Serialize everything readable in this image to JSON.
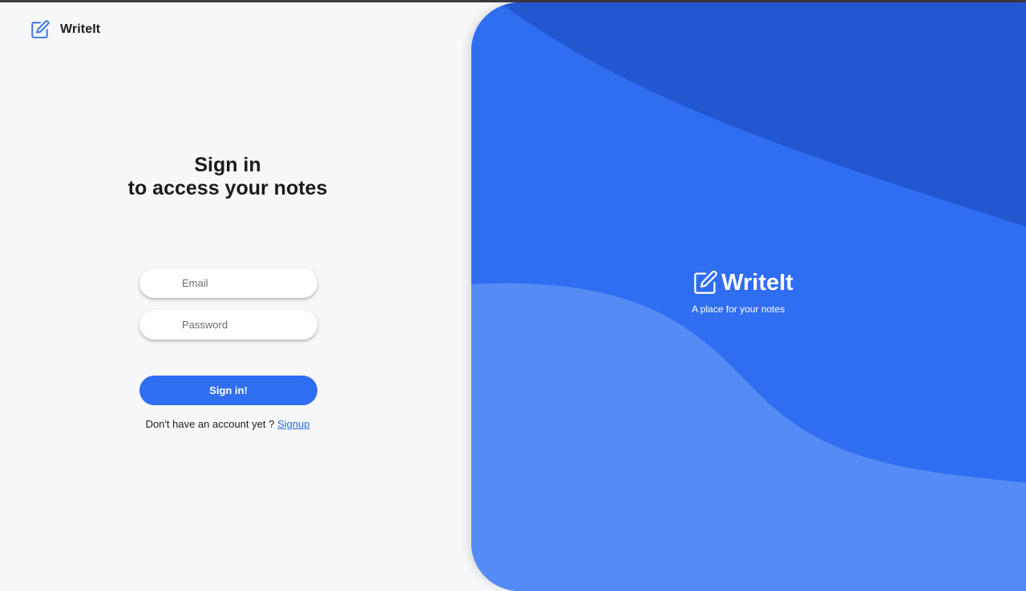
{
  "app": {
    "name": "WriteIt"
  },
  "login": {
    "heading_line1": "Sign in",
    "heading_line2": "to access your notes",
    "email_placeholder": "Email",
    "password_placeholder": "Password",
    "submit_label": "Sign in!",
    "signup_prompt": "Don't have an account yet ?",
    "signup_link": "Signup"
  },
  "hero": {
    "title": "WriteIt",
    "tagline": "A place for your notes"
  },
  "icons": {
    "brand": "edit-note-icon"
  },
  "colors": {
    "accent": "#2f6df1",
    "accent_dark": "#2257cf",
    "accent_light": "#548bf4",
    "link": "#2a6bd6",
    "background": "#f6f8fa"
  }
}
